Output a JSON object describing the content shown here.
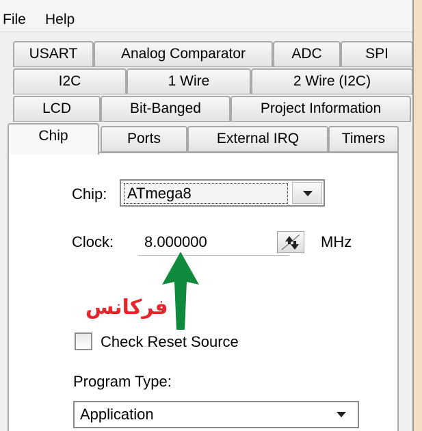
{
  "menubar": {
    "items": [
      "File",
      "Help"
    ]
  },
  "tabs": {
    "row1": [
      "USART",
      "Analog Comparator",
      "ADC",
      "SPI"
    ],
    "row2": [
      "I2C",
      "1 Wire",
      "2 Wire (I2C)"
    ],
    "row3": [
      "LCD",
      "Bit-Banged",
      "Project Information"
    ],
    "row4": [
      "Chip",
      "Ports",
      "External IRQ",
      "Timers"
    ],
    "active": "Chip"
  },
  "chip": {
    "label": "Chip:",
    "value": "ATmega8"
  },
  "clock": {
    "label": "Clock:",
    "value": "8.000000",
    "unit": "MHz"
  },
  "annotation": {
    "text": "فرکانس",
    "color": "#e4262a",
    "arrow_color": "#0f8a3c"
  },
  "check_reset": {
    "label": "Check Reset Source",
    "checked": false
  },
  "program_type": {
    "label": "Program Type:",
    "value": "Application"
  }
}
